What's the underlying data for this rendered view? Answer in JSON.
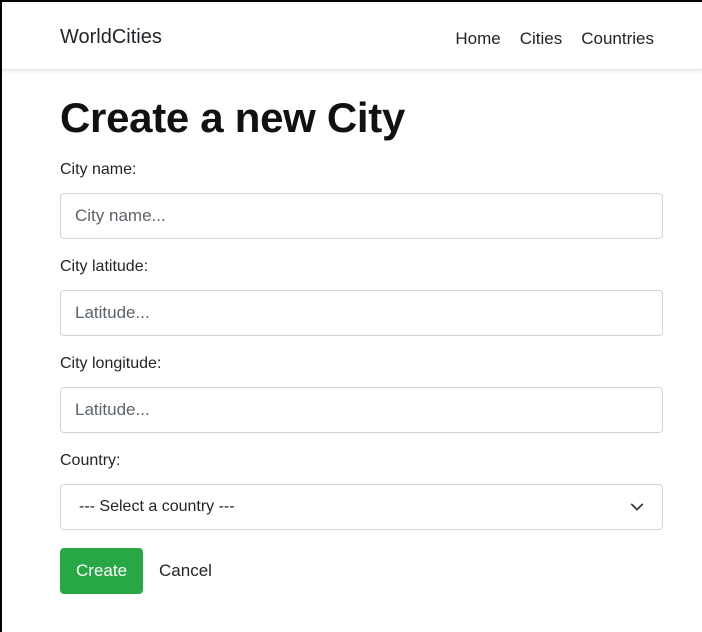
{
  "navbar": {
    "brand": "WorldCities",
    "links": [
      "Home",
      "Cities",
      "Countries"
    ]
  },
  "page": {
    "title": "Create a new City"
  },
  "form": {
    "name": {
      "label": "City name:",
      "placeholder": "City name...",
      "value": ""
    },
    "latitude": {
      "label": "City latitude:",
      "placeholder": "Latitude...",
      "value": ""
    },
    "longitude": {
      "label": "City longitude:",
      "placeholder": "Latitude...",
      "value": ""
    },
    "country": {
      "label": "Country:",
      "selected": "--- Select a country ---"
    },
    "create_label": "Create",
    "cancel_label": "Cancel"
  },
  "colors": {
    "create_button": "#28a745",
    "border": "#ced4da"
  },
  "icons": {
    "select_chevron": "chevron-down-icon"
  }
}
